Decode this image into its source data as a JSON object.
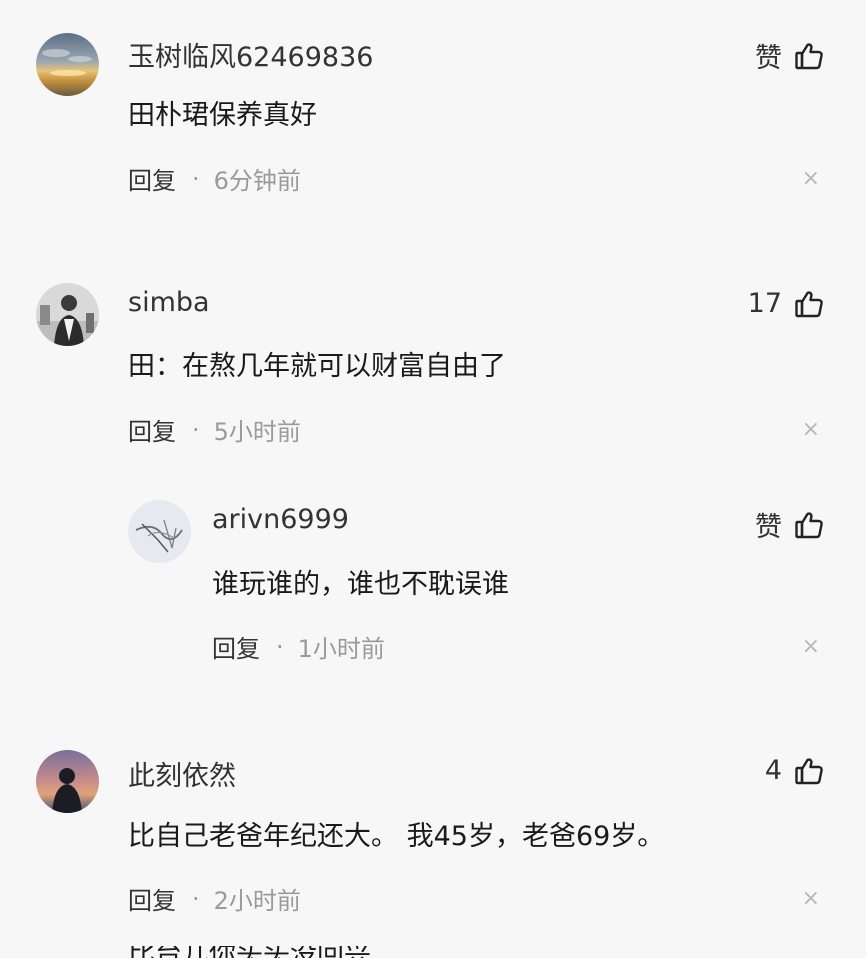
{
  "comments": [
    {
      "username": "玉树临风62469836",
      "text": "田朴珺保养真好",
      "likes": "赞",
      "reply_label": "回复",
      "separator": "·",
      "time": "6分钟前",
      "close": "×",
      "avatar": "sunset-sky-avatar"
    },
    {
      "username": "simba",
      "text": "田：在熬几年就可以财富自由了",
      "likes": "17",
      "reply_label": "回复",
      "separator": "·",
      "time": "5小时前",
      "close": "×",
      "avatar": "man-portrait-avatar"
    },
    {
      "username": "arivn6999",
      "text": "谁玩谁的，谁也不耽误谁",
      "likes": "赞",
      "reply_label": "回复",
      "separator": "·",
      "time": "1小时前",
      "close": "×",
      "avatar": "sketch-drawing-avatar"
    },
    {
      "username": "此刻依然",
      "text": "比自己老爸年纪还大。 我45岁，老爸69岁。",
      "likes": "4",
      "reply_label": "回复",
      "separator": "·",
      "time": "2小时前",
      "close": "×",
      "avatar": "silhouette-dusk-avatar"
    }
  ],
  "cutoff_text": "比台儿你头头没回兴",
  "icons": {
    "like": "thumbs-up-icon",
    "close": "close-icon"
  },
  "colors": {
    "background": "#f7f7f8",
    "text": "#1a1a1a",
    "muted": "#9a9a9a"
  }
}
